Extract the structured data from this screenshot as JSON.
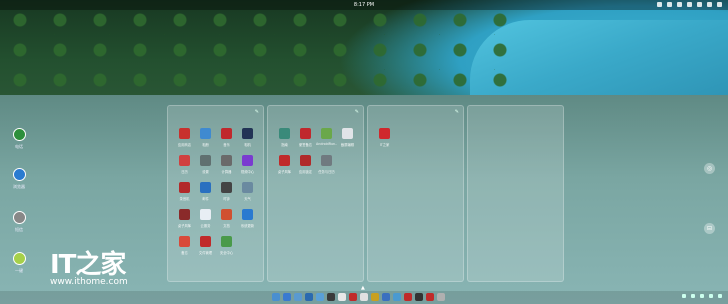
{
  "status_bar": {
    "time": "8:17 PM"
  },
  "left_dock": [
    {
      "label": "电话",
      "icon": "phone-icon",
      "color": "#2d8f3c"
    },
    {
      "label": "浏览器",
      "icon": "browser-icon",
      "color": "#2a7bd0"
    },
    {
      "label": "短信",
      "icon": "message-icon",
      "color": "#888888"
    },
    {
      "label": "一键",
      "icon": "onekey-icon",
      "color": "#a6d04a"
    }
  ],
  "panels": [
    {
      "apps": [
        {
          "label": "应用商店",
          "icon": "app-store-icon",
          "color": "#c8312e"
        },
        {
          "label": "相册",
          "icon": "gallery-icon",
          "color": "#3f8ad0"
        },
        {
          "label": "音乐",
          "icon": "music-icon",
          "color": "#c0282d"
        },
        {
          "label": "相机",
          "icon": "camera-icon",
          "color": "#223355"
        },
        {
          "label": "日历",
          "icon": "calendar-icon",
          "color": "#d04040"
        },
        {
          "label": "设置",
          "icon": "settings-icon",
          "color": "#607070"
        },
        {
          "label": "计算器",
          "icon": "calculator-icon",
          "color": "#6a6a6a"
        },
        {
          "label": "视频中心",
          "icon": "video-icon",
          "color": "#7a3bd0"
        },
        {
          "label": "录音机",
          "icon": "recorder-icon",
          "color": "#b22a2a"
        },
        {
          "label": "邮件",
          "icon": "mail-icon",
          "color": "#2a70c0"
        },
        {
          "label": "时钟",
          "icon": "clock-icon",
          "color": "#444444"
        },
        {
          "label": "天气",
          "icon": "weather-icon",
          "color": "#6a8aa0"
        },
        {
          "label": "桌子风筝",
          "icon": "kite-icon",
          "color": "#8a2a2a"
        },
        {
          "label": "云服务",
          "icon": "cloud-icon",
          "color": "#e8eef4"
        },
        {
          "label": "文档",
          "icon": "docs-icon",
          "color": "#d05030"
        },
        {
          "label": "系统更新",
          "icon": "update-icon",
          "color": "#2a7ad0"
        },
        {
          "label": "备忘",
          "icon": "notes-icon",
          "color": "#d84a3a"
        },
        {
          "label": "文件管理",
          "icon": "files-icon",
          "color": "#c02a2a"
        },
        {
          "label": "安全中心",
          "icon": "security-icon",
          "color": "#4a9a4a"
        }
      ]
    },
    {
      "apps": [
        {
          "label": "指南",
          "icon": "guide-icon",
          "color": "#3a8a7a"
        },
        {
          "label": "便签备忘",
          "icon": "memo-icon",
          "color": "#c0282d"
        },
        {
          "label": "AndroidRun...",
          "icon": "android-icon",
          "color": "#6aa84a"
        },
        {
          "label": "截屏编辑",
          "icon": "screenshot-icon",
          "color": "#e0e4e8"
        },
        {
          "label": "桌子风筝",
          "icon": "kite2-icon",
          "color": "#c02a2a"
        },
        {
          "label": "应用锁定",
          "icon": "lock-icon",
          "color": "#b02a2a"
        },
        {
          "label": "任务与日历",
          "icon": "tasks-icon",
          "color": "#707a80"
        }
      ]
    },
    {
      "apps": [
        {
          "label": "IT之家",
          "icon": "ithome-icon",
          "color": "#d0282d"
        }
      ]
    },
    {
      "apps": []
    }
  ],
  "watermark": {
    "logo": "IT之家",
    "url": "www.ithome.com"
  },
  "taskbar_colors": [
    "#4a8fd0",
    "#3a7ad0",
    "#5a9ad0",
    "#2a6ab0",
    "#5aa0d8",
    "#3a3a3a",
    "#e8e8e8",
    "#c02a2a",
    "#e0e0e0",
    "#c8a020",
    "#3a70c0",
    "#4a9ad0",
    "#c02a2a",
    "#333333",
    "#c02a2a",
    "#b0b0b0"
  ]
}
